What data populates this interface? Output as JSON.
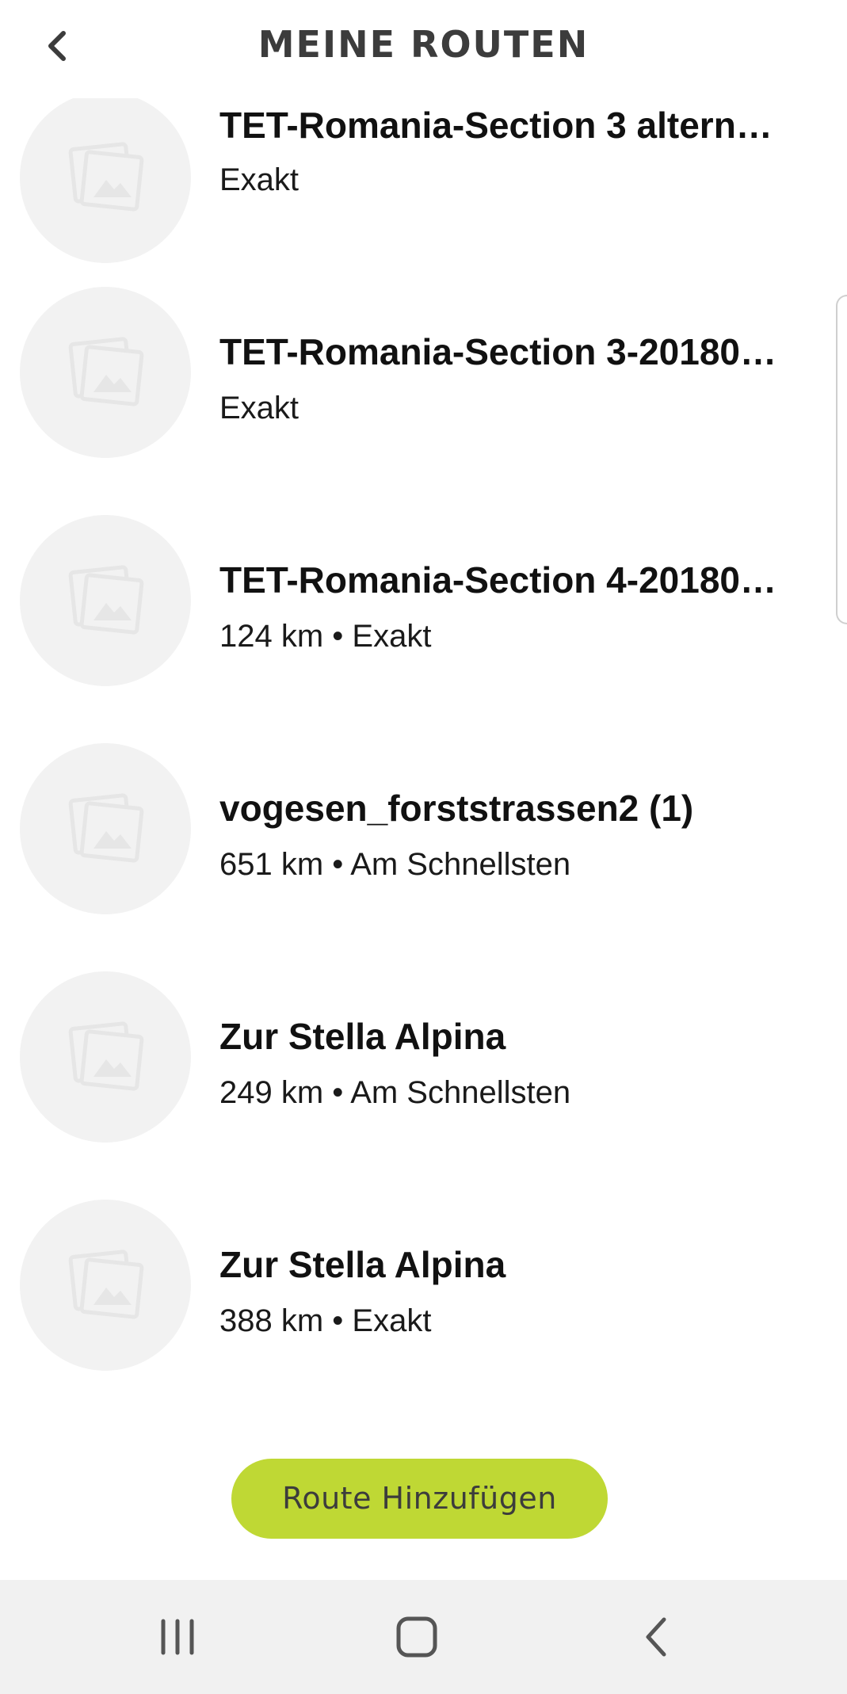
{
  "header": {
    "title": "MEINE ROUTEN",
    "back_icon": "chevron-left-icon"
  },
  "routes": [
    {
      "name": "TET-Romania-Section 3 alterna…",
      "meta": "Exakt",
      "thumbnail_icon": "image-placeholder-icon"
    },
    {
      "name": "TET-Romania-Section 3-20180…",
      "meta": "Exakt",
      "thumbnail_icon": "image-placeholder-icon"
    },
    {
      "name": "TET-Romania-Section 4-20180…",
      "meta": "124 km • Exakt",
      "thumbnail_icon": "image-placeholder-icon"
    },
    {
      "name": "vogesen_forststrassen2 (1)",
      "meta": "651 km • Am Schnellsten",
      "thumbnail_icon": "image-placeholder-icon"
    },
    {
      "name": "Zur Stella Alpina",
      "meta": "249 km • Am Schnellsten",
      "thumbnail_icon": "image-placeholder-icon"
    },
    {
      "name": "Zur Stella Alpina",
      "meta": "388 km • Exakt",
      "thumbnail_icon": "image-placeholder-icon"
    }
  ],
  "add_button": {
    "label": "Route Hinzufügen",
    "color": "#bfd834"
  },
  "system_nav": {
    "recents_icon": "recent-apps-icon",
    "home_icon": "home-icon",
    "back_icon": "back-icon"
  },
  "colors": {
    "accent": "#bfd834",
    "title_text": "#3c3c3c",
    "placeholder_bg": "#f2f2f2",
    "nav_bar_bg": "#f1f1f1"
  }
}
